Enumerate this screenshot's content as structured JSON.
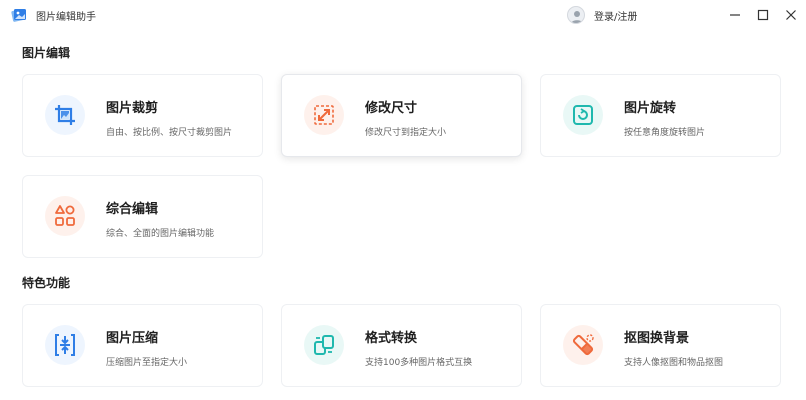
{
  "titlebar": {
    "app_name": "图片编辑助手",
    "login_label": "登录/注册"
  },
  "sections": [
    {
      "title": "图片编辑",
      "cards": [
        {
          "title": "图片裁剪",
          "desc": "自由、按比例、按尺寸裁剪图片",
          "icon": "crop-icon",
          "color": "#2f7ee6"
        },
        {
          "title": "修改尺寸",
          "desc": "修改尺寸到指定大小",
          "icon": "resize-icon",
          "color": "#ef6a3c"
        },
        {
          "title": "图片旋转",
          "desc": "按任意角度旋转图片",
          "icon": "rotate-icon",
          "color": "#1fb8ae"
        },
        {
          "title": "综合编辑",
          "desc": "综合、全面的图片编辑功能",
          "icon": "shapes-icon",
          "color": "#ef6a3c"
        }
      ]
    },
    {
      "title": "特色功能",
      "cards": [
        {
          "title": "图片压缩",
          "desc": "压缩图片至指定大小",
          "icon": "compress-icon",
          "color": "#2f7ee6"
        },
        {
          "title": "格式转换",
          "desc": "支持100多种图片格式互换",
          "icon": "convert-icon",
          "color": "#1fb8ae"
        },
        {
          "title": "抠图换背景",
          "desc": "支持人像抠图和物品抠图",
          "icon": "eraser-icon",
          "color": "#ef6a3c"
        }
      ]
    }
  ]
}
